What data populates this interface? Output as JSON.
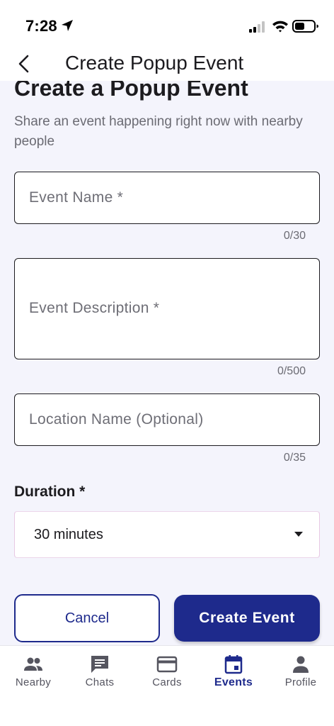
{
  "status_bar": {
    "time": "7:28"
  },
  "app_bar": {
    "title": "Create Popup Event"
  },
  "form": {
    "heading": "Create a Popup Event",
    "subtitle": "Share an event happening right now with nearby people",
    "event_name": {
      "value": "",
      "placeholder": "Event Name *",
      "counter": "0/30"
    },
    "event_description": {
      "value": "",
      "placeholder": "Event Description *",
      "counter": "0/500"
    },
    "location_name": {
      "value": "",
      "placeholder": "Location Name (Optional)",
      "counter": "0/35"
    },
    "duration": {
      "label": "Duration *",
      "selected": "30 minutes"
    },
    "cancel_label": "Cancel",
    "create_label": "Create Event"
  },
  "bottom_nav": {
    "items": [
      {
        "label": "Nearby",
        "icon": "people-icon"
      },
      {
        "label": "Chats",
        "icon": "chat-icon"
      },
      {
        "label": "Cards",
        "icon": "card-icon"
      },
      {
        "label": "Events",
        "icon": "calendar-icon",
        "active": true
      },
      {
        "label": "Profile",
        "icon": "person-icon"
      }
    ]
  },
  "colors": {
    "primary": "#1e2a8c",
    "background": "#f4f4fc",
    "text": "#1c1b1f",
    "muted": "#6b6b73"
  }
}
